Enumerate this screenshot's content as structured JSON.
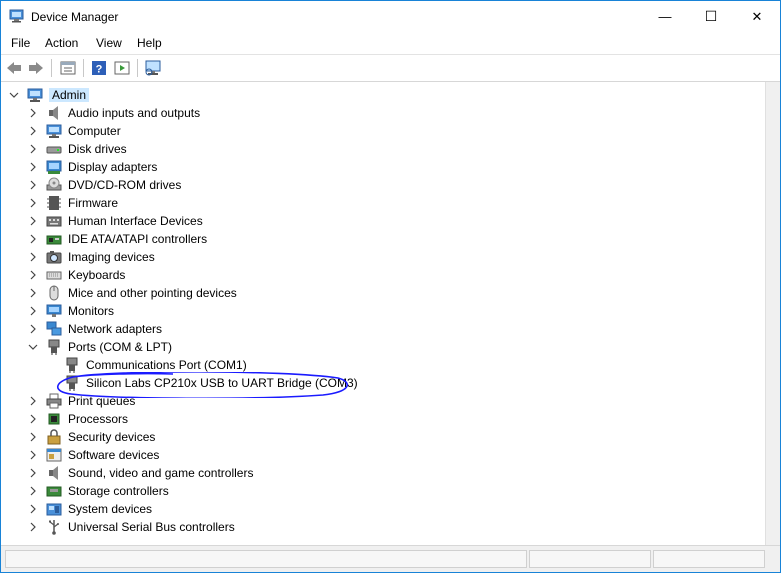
{
  "window": {
    "title": "Device Manager",
    "controls": {
      "minimize": "—",
      "maximize": "☐",
      "close": "✕"
    }
  },
  "menu": [
    "File",
    "Action",
    "View",
    "Help"
  ],
  "toolbar": [
    "back-icon",
    "forward-icon",
    "properties-icon",
    "help-icon",
    "run-icon",
    "scan-hardware-icon"
  ],
  "tree": {
    "root": "Admin",
    "categories": [
      {
        "label": "Audio inputs and outputs",
        "icon": "speaker-icon"
      },
      {
        "label": "Computer",
        "icon": "computer-icon"
      },
      {
        "label": "Disk drives",
        "icon": "disk-drive-icon"
      },
      {
        "label": "Display adapters",
        "icon": "display-adapter-icon"
      },
      {
        "label": "DVD/CD-ROM drives",
        "icon": "dvd-drive-icon"
      },
      {
        "label": "Firmware",
        "icon": "firmware-icon"
      },
      {
        "label": "Human Interface Devices",
        "icon": "hid-icon"
      },
      {
        "label": "IDE ATA/ATAPI controllers",
        "icon": "ide-controller-icon"
      },
      {
        "label": "Imaging devices",
        "icon": "camera-icon"
      },
      {
        "label": "Keyboards",
        "icon": "keyboard-icon"
      },
      {
        "label": "Mice and other pointing devices",
        "icon": "mouse-icon"
      },
      {
        "label": "Monitors",
        "icon": "monitor-icon"
      },
      {
        "label": "Network adapters",
        "icon": "network-adapter-icon"
      },
      {
        "label": "Ports (COM & LPT)",
        "icon": "port-icon",
        "expanded": true,
        "children": [
          {
            "label": "Communications Port (COM1)",
            "icon": "port-icon"
          },
          {
            "label": "Silicon Labs CP210x USB to UART Bridge (COM3)",
            "icon": "port-icon",
            "annotated": true
          }
        ]
      },
      {
        "label": "Print queues",
        "icon": "printer-icon"
      },
      {
        "label": "Processors",
        "icon": "processor-icon"
      },
      {
        "label": "Security devices",
        "icon": "security-device-icon"
      },
      {
        "label": "Software devices",
        "icon": "software-device-icon"
      },
      {
        "label": "Sound, video and game controllers",
        "icon": "sound-controller-icon"
      },
      {
        "label": "Storage controllers",
        "icon": "storage-controller-icon"
      },
      {
        "label": "System devices",
        "icon": "system-device-icon"
      },
      {
        "label": "Universal Serial Bus controllers",
        "icon": "usb-controller-icon"
      }
    ]
  },
  "colors": {
    "selection": "#cce8ff",
    "annotation": "#1a1aff",
    "window_border": "#1883d7"
  }
}
